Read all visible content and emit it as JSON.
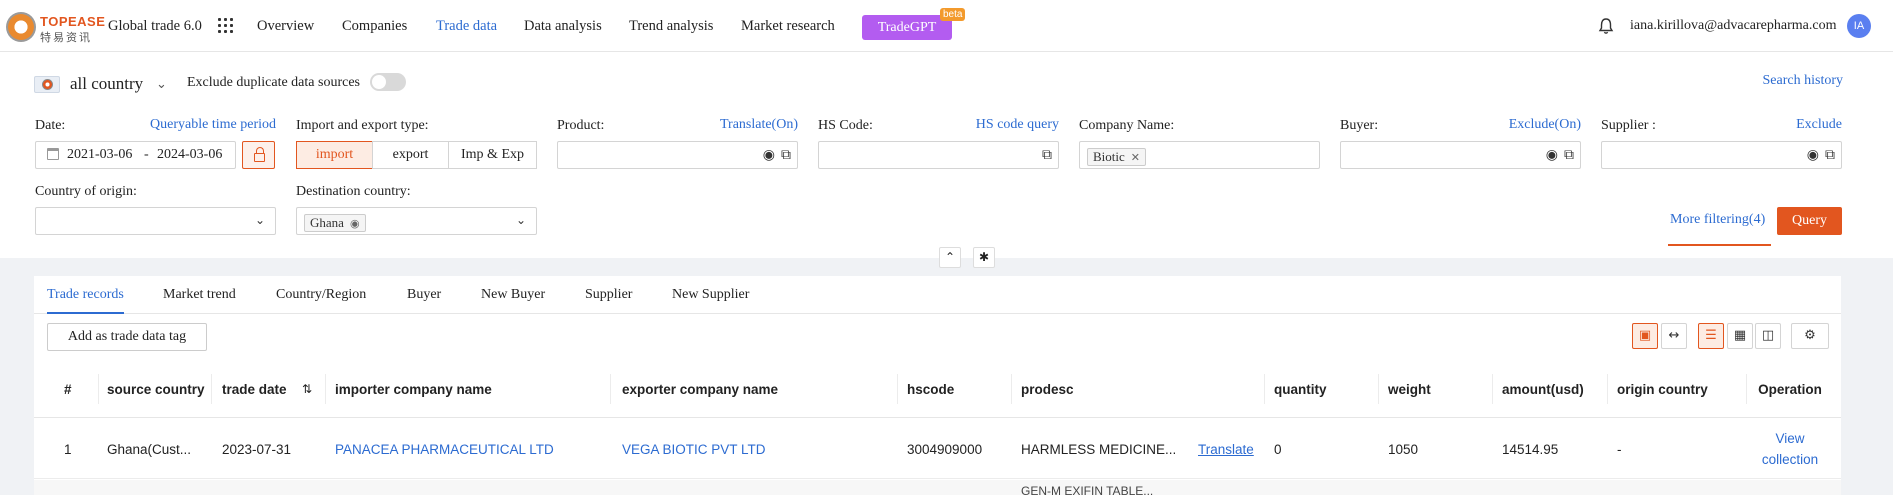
{
  "nav": {
    "logo_text_en": "TOPEASE",
    "logo_text_cn": "特易资讯",
    "app_title": "Global trade 6.0",
    "items": [
      "Overview",
      "Companies",
      "Trade data",
      "Data analysis",
      "Trend analysis",
      "Market research"
    ],
    "active_item": "Trade data",
    "tradegpt_label": "TradeGPT",
    "tradegpt_badge": "beta",
    "user_email": "iana.kirillova@advacarepharma.com",
    "avatar_initials": "IA"
  },
  "filters": {
    "country_label": "all country",
    "exclude_duplicate_label": "Exclude duplicate data sources",
    "exclude_duplicate_on": false,
    "search_history_link": "Search history",
    "date_label": "Date:",
    "date_link": "Queryable time period",
    "date_start": "2021-03-06",
    "date_separator": "-",
    "date_end": "2024-03-06",
    "ie_type_label": "Import and export type:",
    "ie_type_options": [
      "import",
      "export",
      "Imp & Exp"
    ],
    "ie_type_selected": "import",
    "product_label": "Product:",
    "product_link": "Translate(On)",
    "product_value": "",
    "hscode_label": "HS Code:",
    "hscode_link": "HS code query",
    "hscode_value": "",
    "company_label": "Company Name:",
    "company_tag": "Biotic",
    "buyer_label": "Buyer:",
    "buyer_link": "Exclude(On)",
    "buyer_value": "",
    "supplier_label": "Supplier :",
    "supplier_link": "Exclude",
    "supplier_value": "",
    "origin_label": "Country of origin:",
    "origin_value": "",
    "destination_label": "Destination country:",
    "destination_tag": "Ghana",
    "more_filtering": "More filtering(4)",
    "query_button": "Query"
  },
  "results": {
    "tabs": [
      "Trade records",
      "Market trend",
      "Country/Region",
      "Buyer",
      "New Buyer",
      "Supplier",
      "New Supplier"
    ],
    "active_tab": "Trade records",
    "add_tag_button": "Add as trade data tag",
    "columns": [
      "#",
      "source country",
      "trade date",
      "importer company name",
      "exporter company name",
      "hscode",
      "prodesc",
      "quantity",
      "weight",
      "amount(usd)",
      "origin country",
      "Operation"
    ],
    "rows": [
      {
        "index": "1",
        "source_country": "Ghana(Cust...",
        "trade_date": "2023-07-31",
        "importer": "PANACEA PHARMACEUTICAL LTD",
        "exporter": "VEGA BIOTIC PVT LTD",
        "hscode": "3004909000",
        "prodesc": "HARMLESS MEDICINE...",
        "translate": "Translate",
        "quantity": "0",
        "weight": "1050",
        "amount": "14514.95",
        "origin_country": "-",
        "operation": "View collection"
      }
    ],
    "next_row_partial_text": "GEN-M EXIFIN TABLE..."
  },
  "colors": {
    "accent_orange": "#e2561f",
    "link_blue": "#2c6bd1",
    "tradegpt_purple": "#b35cf0",
    "avatar_blue": "#5a7ff0"
  },
  "icons": [
    "grid-menu-icon",
    "bell-icon",
    "calendar-icon",
    "lock-icon",
    "camera-search-icon",
    "copy-icon",
    "chevron-down-icon",
    "close-icon",
    "chevron-up-icon",
    "pin-icon",
    "fullscreen-icon",
    "fit-width-icon",
    "list-view-icon",
    "grid-view-icon",
    "card-view-icon",
    "settings-icon",
    "sort-icon"
  ]
}
